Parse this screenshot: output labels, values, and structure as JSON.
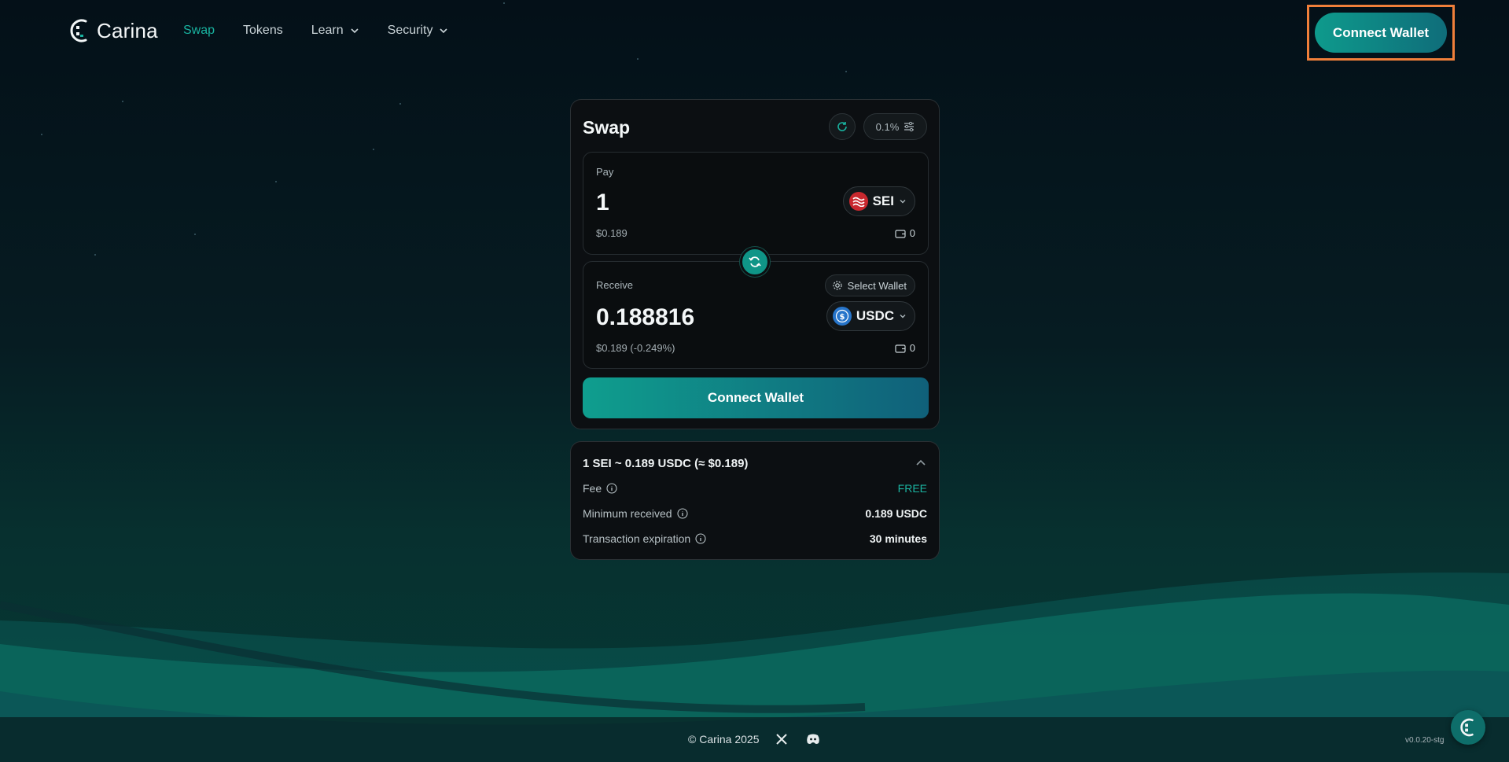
{
  "brand": {
    "name": "Carina"
  },
  "nav": {
    "items": [
      {
        "label": "Swap",
        "active": true,
        "dropdown": false
      },
      {
        "label": "Tokens",
        "active": false,
        "dropdown": false
      },
      {
        "label": "Learn",
        "active": false,
        "dropdown": true
      },
      {
        "label": "Security",
        "active": false,
        "dropdown": true
      }
    ]
  },
  "header": {
    "connect_label": "Connect Wallet"
  },
  "swap": {
    "title": "Swap",
    "slippage": "0.1%",
    "pay": {
      "label": "Pay",
      "amount": "1",
      "usd": "$0.189",
      "token": "SEI",
      "token_icon": "sei-token-icon",
      "balance": "0"
    },
    "receive": {
      "label": "Receive",
      "select_wallet": "Select Wallet",
      "amount": "0.188816",
      "usd": "$0.189 (-0.249%)",
      "token": "USDC",
      "token_icon": "usdc-token-icon",
      "balance": "0"
    },
    "connect_label": "Connect Wallet"
  },
  "details": {
    "rate": "1 SEI ~ 0.189 USDC (≈ $0.189)",
    "fee_label": "Fee",
    "fee_value": "FREE",
    "min_label": "Minimum received",
    "min_value": "0.189 USDC",
    "exp_label": "Transaction expiration",
    "exp_value": "30 minutes"
  },
  "footer": {
    "copyright": "© Carina 2025",
    "version": "v0.0.20-stg"
  },
  "colors": {
    "accent": "#19b3a0",
    "highlight_border": "#f07f3a",
    "card_bg": "#0c0f12"
  }
}
